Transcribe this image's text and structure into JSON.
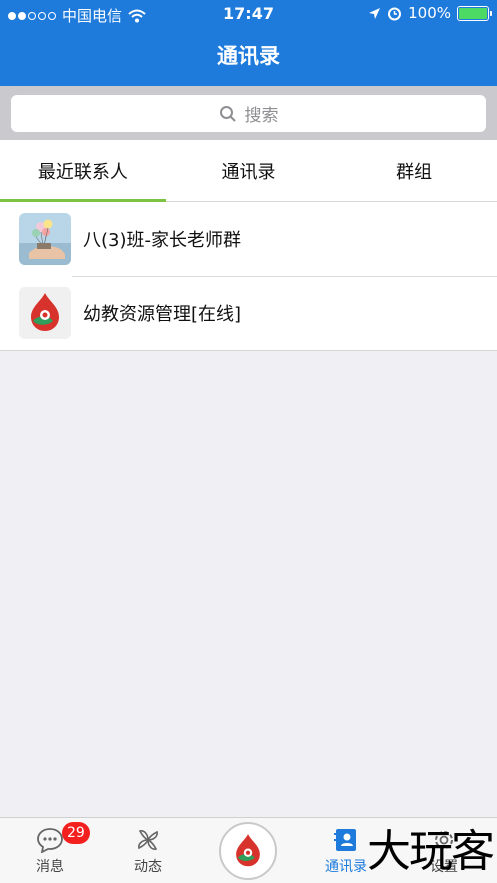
{
  "status_bar": {
    "carrier": "中国电信",
    "time": "17:47",
    "battery": "100%"
  },
  "nav": {
    "title": "通讯录"
  },
  "search": {
    "placeholder": "搜索"
  },
  "tabs": [
    {
      "label": "最近联系人",
      "active": true
    },
    {
      "label": "通讯录",
      "active": false
    },
    {
      "label": "群组",
      "active": false
    }
  ],
  "contacts": [
    {
      "name": "八(3)班-家长老师群",
      "avatar": "balloon-photo"
    },
    {
      "name": "幼教资源管理[在线]",
      "avatar": "app-logo"
    }
  ],
  "tabbar": {
    "items": [
      {
        "label": "消息",
        "icon": "chat-bubble-icon",
        "badge": "29"
      },
      {
        "label": "动态",
        "icon": "pinwheel-icon"
      },
      {
        "label": "",
        "icon": "app-logo"
      },
      {
        "label": "通讯录",
        "icon": "contacts-icon",
        "active": true
      },
      {
        "label": "设置",
        "icon": "gear-icon"
      }
    ]
  },
  "watermark": "大玩客",
  "colors": {
    "primary": "#1e7bdc",
    "tab_indicator": "#7cc243",
    "badge": "#f41f1f"
  }
}
